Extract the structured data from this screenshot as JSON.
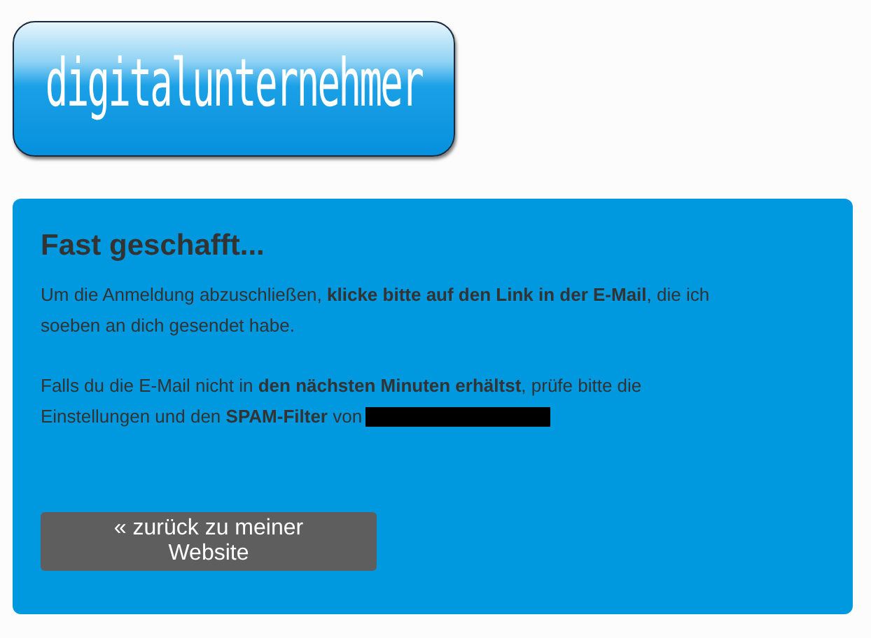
{
  "logo": {
    "text": "digitalunternehmer"
  },
  "card": {
    "title": "Fast geschafft...",
    "paragraphs": [
      {
        "text": "Um die Anmeldung abzuschließen, **klicke bitte auf den Link in der E-Mail**, die ich soeben an dich gesendet habe.",
        "redacted": false
      },
      {
        "text": "Falls du die E-Mail nicht in **den nächsten Minuten erhältst**, prüfe bitte die Einstellungen und den **SPAM-Filter** von",
        "redacted": true
      }
    ],
    "button": "« zurück zu meiner Website"
  }
}
